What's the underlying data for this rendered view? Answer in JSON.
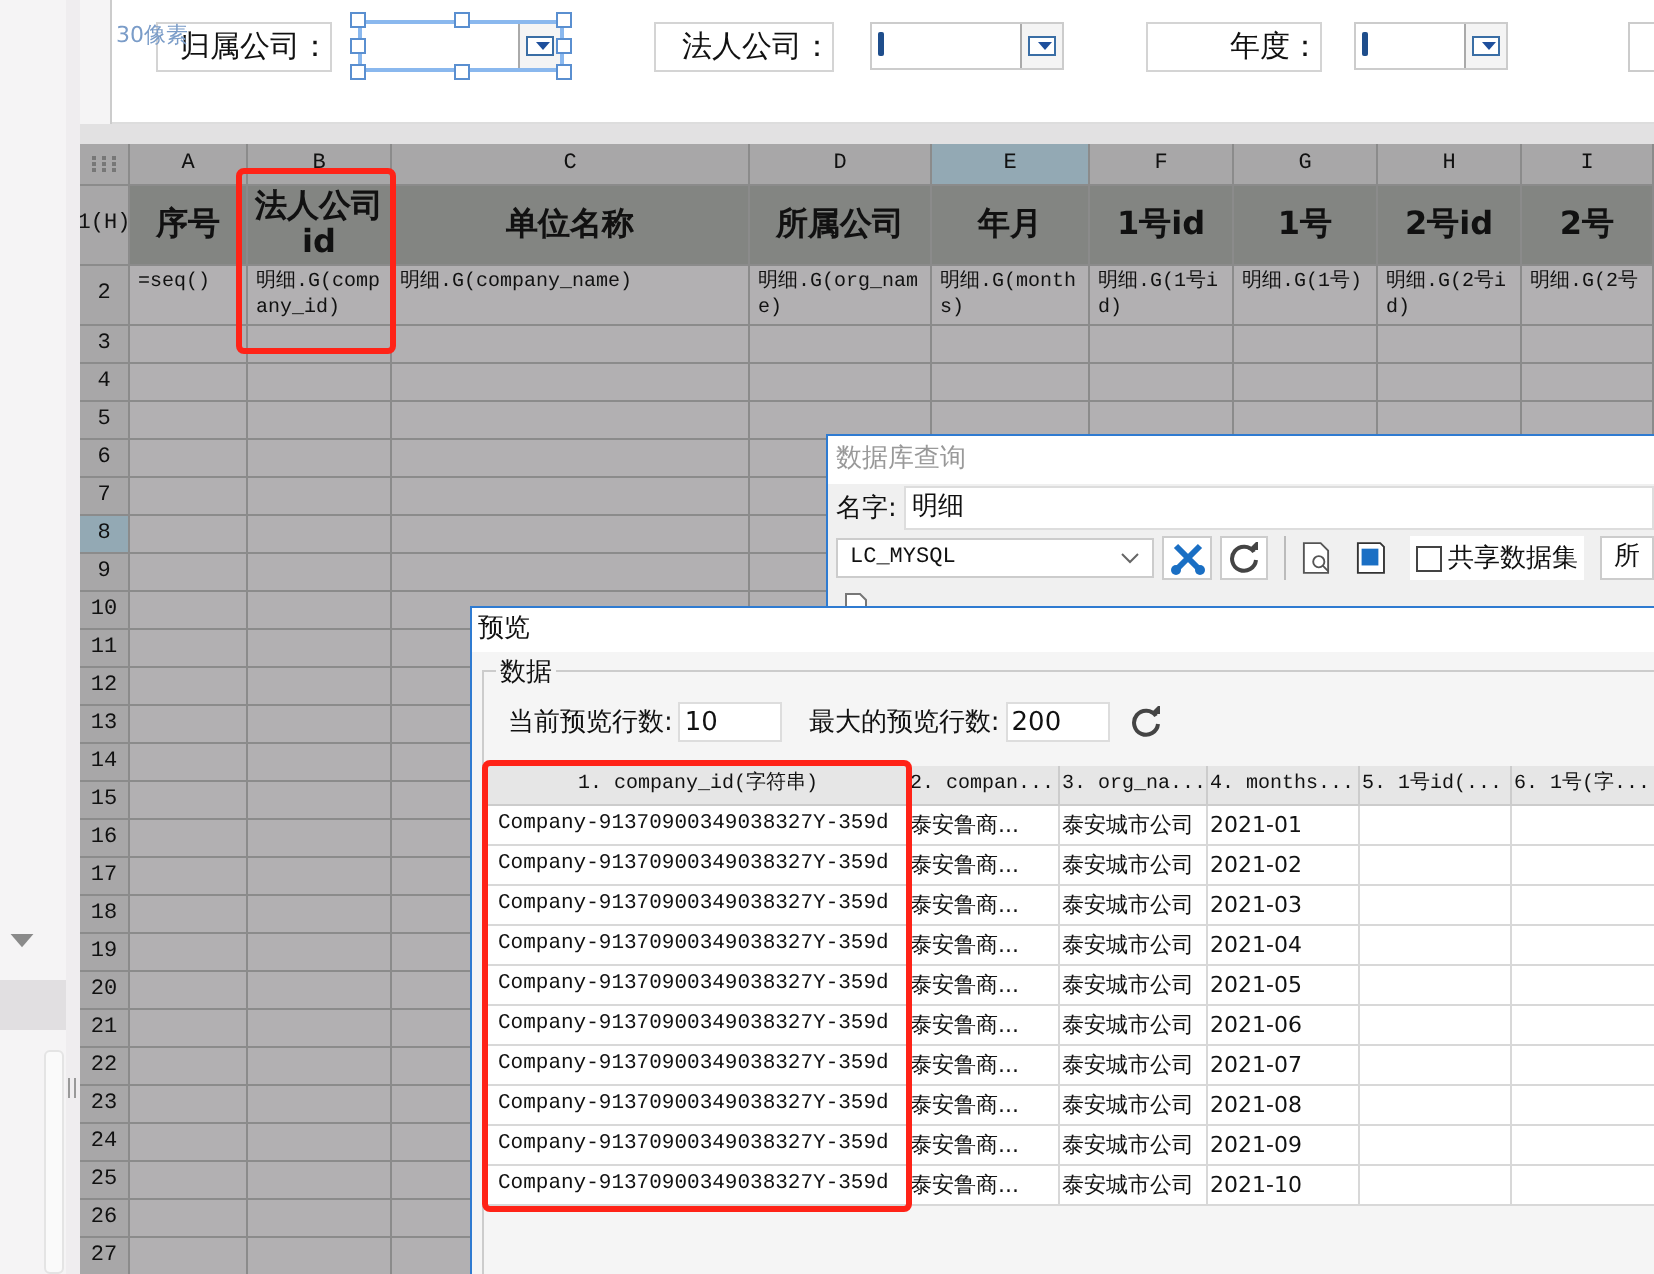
{
  "ruler_label": "30像素",
  "params": [
    {
      "label": "归属公司：",
      "selected": true
    },
    {
      "label": "法人公司：",
      "selected": false
    },
    {
      "label": "年度：",
      "selected": false
    }
  ],
  "sheet": {
    "columns": [
      {
        "label": "A",
        "selected": false,
        "highlighted": false
      },
      {
        "label": "B",
        "selected": false,
        "highlighted": true
      },
      {
        "label": "C",
        "selected": false,
        "highlighted": false
      },
      {
        "label": "D",
        "selected": false,
        "highlighted": false
      },
      {
        "label": "E",
        "selected": true,
        "highlighted": false
      },
      {
        "label": "F",
        "selected": false,
        "highlighted": false
      },
      {
        "label": "G",
        "selected": false,
        "highlighted": false
      },
      {
        "label": "H",
        "selected": false,
        "highlighted": false
      },
      {
        "label": "I",
        "selected": false,
        "highlighted": false
      }
    ],
    "rows": [
      {
        "label": "1(H)",
        "selected": false
      },
      {
        "label": "2",
        "selected": false
      },
      {
        "label": "3",
        "selected": false
      },
      {
        "label": "4",
        "selected": false
      },
      {
        "label": "5",
        "selected": false
      },
      {
        "label": "6",
        "selected": false
      },
      {
        "label": "7",
        "selected": false
      },
      {
        "label": "8",
        "selected": true
      },
      {
        "label": "9",
        "selected": false
      },
      {
        "label": "10",
        "selected": false
      },
      {
        "label": "11",
        "selected": false
      },
      {
        "label": "12",
        "selected": false
      },
      {
        "label": "13",
        "selected": false
      },
      {
        "label": "14",
        "selected": false
      },
      {
        "label": "15",
        "selected": false
      },
      {
        "label": "16",
        "selected": false
      },
      {
        "label": "17",
        "selected": false
      },
      {
        "label": "18",
        "selected": false
      },
      {
        "label": "19",
        "selected": false
      },
      {
        "label": "20",
        "selected": false
      },
      {
        "label": "21",
        "selected": false
      },
      {
        "label": "22",
        "selected": false
      },
      {
        "label": "23",
        "selected": false
      },
      {
        "label": "24",
        "selected": false
      },
      {
        "label": "25",
        "selected": false
      },
      {
        "label": "26",
        "selected": false
      },
      {
        "label": "27",
        "selected": false
      }
    ],
    "header_cells": [
      "序号",
      "法人公司id",
      "单位名称",
      "所属公司",
      "年月",
      "1号id",
      "1号",
      "2号id",
      "2号"
    ],
    "formula_cells": [
      "=seq()",
      "明细.G(company_id)",
      "明细.G(company_name)",
      "明细.G(org_name)",
      "明细.G(months)",
      "明细.G(1号id)",
      "明细.G(1号)",
      "明细.G(2号id)",
      "明细.G(2号"
    ]
  },
  "db_query": {
    "title": "数据库查询",
    "name_label": "名字:",
    "name_value": "明细",
    "connection": "LC_MYSQL",
    "shared": {
      "label": "共享数据集",
      "checked": false
    },
    "cut_button": "所"
  },
  "preview": {
    "title": "预览",
    "group": "数据",
    "current_label": "当前预览行数:",
    "current_value": "10",
    "max_label": "最大的预览行数:",
    "max_value": "200",
    "columns": [
      {
        "label": "1. company_id(字符串)",
        "highlighted": true
      },
      {
        "label": "2. compan...",
        "highlighted": false
      },
      {
        "label": "3. org_na...",
        "highlighted": false
      },
      {
        "label": "4. months...",
        "highlighted": false
      },
      {
        "label": "5. 1号id(...",
        "highlighted": false
      },
      {
        "label": "6. 1号(字...",
        "highlighted": false
      }
    ],
    "rows": [
      [
        "Company-91370900349038327Y-359d",
        "泰安鲁商...",
        "泰安城市公司",
        "2021-01"
      ],
      [
        "Company-91370900349038327Y-359d",
        "泰安鲁商...",
        "泰安城市公司",
        "2021-02"
      ],
      [
        "Company-91370900349038327Y-359d",
        "泰安鲁商...",
        "泰安城市公司",
        "2021-03"
      ],
      [
        "Company-91370900349038327Y-359d",
        "泰安鲁商...",
        "泰安城市公司",
        "2021-04"
      ],
      [
        "Company-91370900349038327Y-359d",
        "泰安鲁商...",
        "泰安城市公司",
        "2021-05"
      ],
      [
        "Company-91370900349038327Y-359d",
        "泰安鲁商...",
        "泰安城市公司",
        "2021-06"
      ],
      [
        "Company-91370900349038327Y-359d",
        "泰安鲁商...",
        "泰安城市公司",
        "2021-07"
      ],
      [
        "Company-91370900349038327Y-359d",
        "泰安鲁商...",
        "泰安城市公司",
        "2021-08"
      ],
      [
        "Company-91370900349038327Y-359d",
        "泰安鲁商...",
        "泰安城市公司",
        "2021-09"
      ],
      [
        "Company-91370900349038327Y-359d",
        "泰安鲁商...",
        "泰安城市公司",
        "2021-10"
      ]
    ]
  }
}
